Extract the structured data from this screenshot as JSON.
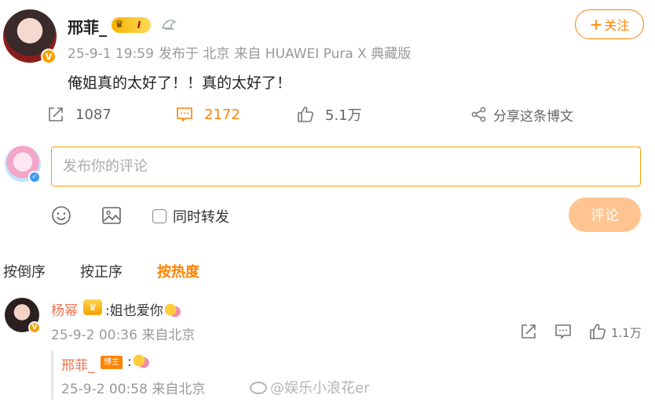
{
  "post": {
    "author": "邢菲_",
    "level": "I",
    "meta": {
      "date": "25-9-1 19:59",
      "location": "发布于 北京",
      "source": "来自 HUAWEI Pura X 典藏版"
    },
    "follow_label": "关注",
    "text": "俺姐真的太好了！！真的太好了！",
    "actions": {
      "repost_count": "1087",
      "comment_count": "2172",
      "like_count": "5.1万",
      "share_label": "分享这条博文"
    }
  },
  "composer": {
    "placeholder": "发布你的评论",
    "repost_label": "同时转发",
    "submit_label": "评论"
  },
  "sort_tabs": [
    {
      "label": "按倒序",
      "active": false
    },
    {
      "label": "按正序",
      "active": false
    },
    {
      "label": "按热度",
      "active": true
    }
  ],
  "comments": [
    {
      "name": "杨幂",
      "text": ":姐也爱你",
      "meta": "25-9-2 00:36 来自北京",
      "like_count": "1.1万",
      "replies": [
        {
          "name": "邢菲_",
          "badge": "博主",
          "text": ":",
          "meta": "25-9-2 00:58 来自北京"
        }
      ]
    }
  ],
  "watermark": "@娱乐小浪花er",
  "colors": {
    "accent": "#ff8200",
    "name_link": "#eb7350",
    "muted": "#999999",
    "submit_disabled": "#ffc48f"
  }
}
